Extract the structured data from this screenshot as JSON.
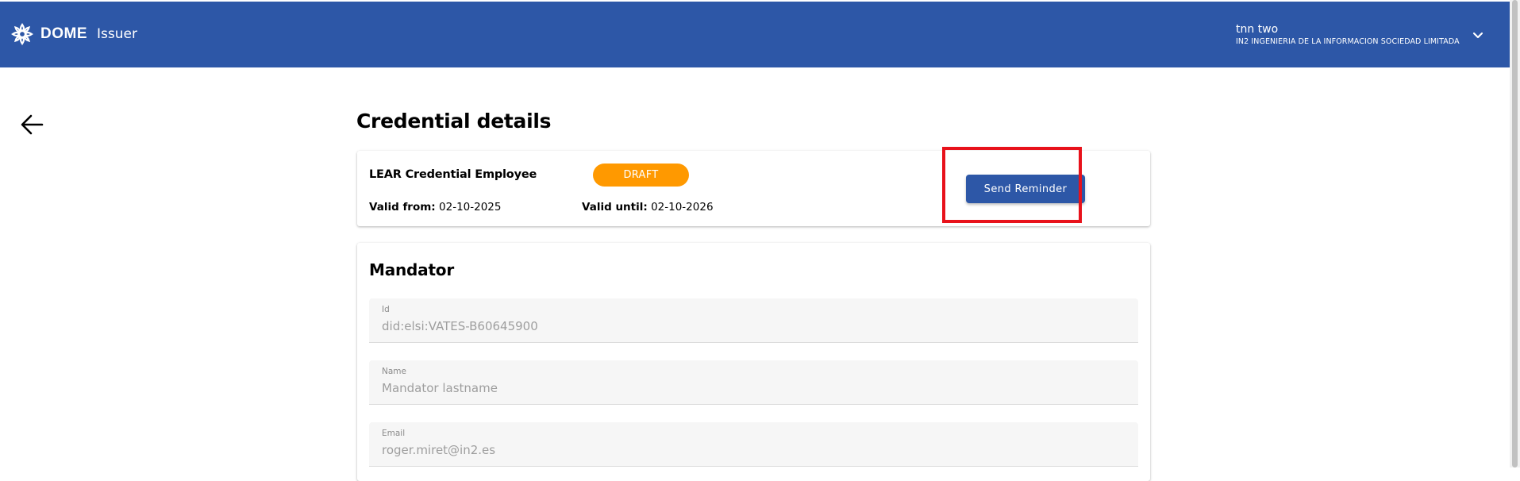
{
  "header": {
    "brand_name": "DOME",
    "brand_suffix": "Issuer",
    "user_name": "tnn two",
    "user_org": "IN2 INGENIERIA DE LA INFORMACION SOCIEDAD LIMITADA",
    "bar_color": "#2d57a7"
  },
  "page": {
    "title": "Credential details"
  },
  "credential": {
    "type": "LEAR Credential Employee",
    "status": "DRAFT",
    "status_color": "#ff9900",
    "valid_from_label": "Valid from:",
    "valid_from": "02-10-2025",
    "valid_until_label": "Valid until:",
    "valid_until": "02-10-2026",
    "send_reminder_label": "Send Reminder"
  },
  "mandator": {
    "title": "Mandator",
    "fields": [
      {
        "label": "Id",
        "value": "did:elsi:VATES-B60645900"
      },
      {
        "label": "Name",
        "value": "Mandator lastname"
      },
      {
        "label": "Email",
        "value": "roger.miret@in2.es"
      }
    ]
  },
  "icons": {
    "logo": "dome-logo-icon",
    "user_menu": "chevron-down-icon",
    "back": "arrow-left-icon"
  },
  "annotation": {
    "highlight_color": "#e8121b"
  }
}
